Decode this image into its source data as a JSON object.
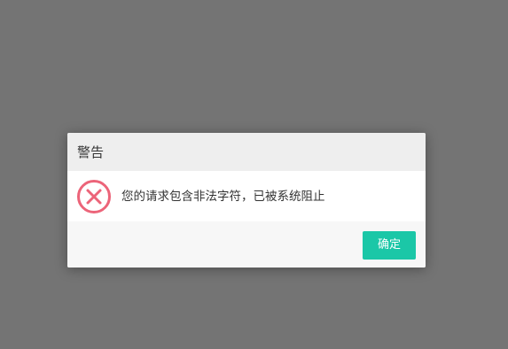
{
  "dialog": {
    "title": "警告",
    "icon": "error-circle-x-icon",
    "message": "您的请求包含非法字符，已被系统阻止",
    "confirm_label": "确定"
  },
  "colors": {
    "backdrop": "#747474",
    "header": "#eeeeee",
    "footer": "#f7f7f7",
    "error_icon": "#ec6479",
    "confirm_button": "#1bc7a7"
  }
}
